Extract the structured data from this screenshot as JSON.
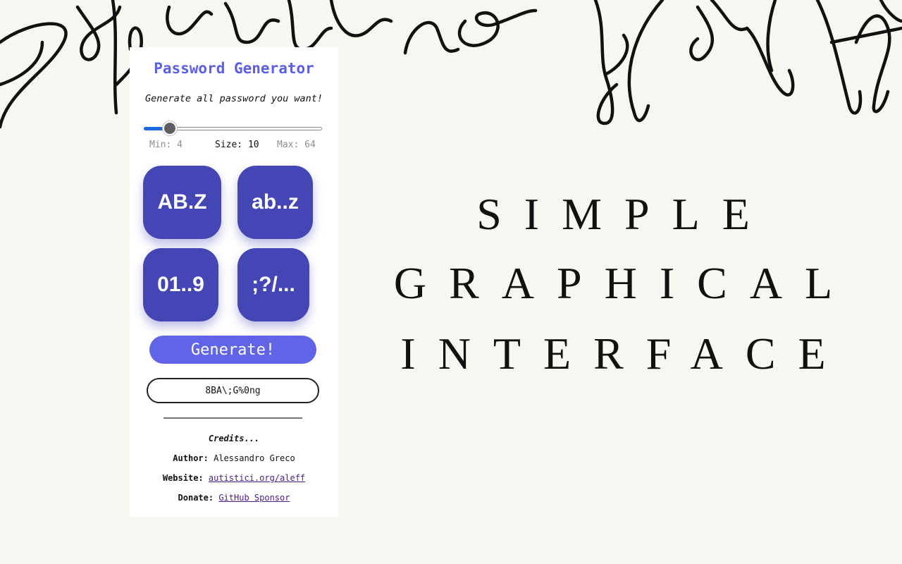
{
  "background": {
    "signature_text": "Sebastiano Beretta",
    "color": "#f7f6f1"
  },
  "panel": {
    "title": "Password Generator",
    "subtitle": "Generate all password you want!",
    "slider": {
      "value": 10,
      "min": 4,
      "max": 64,
      "fill_color": "#1a6ae0"
    },
    "size_row": {
      "min_text": "Min: 4",
      "size_label": "Size:",
      "size_value": "10",
      "max_text": "Max: 64"
    },
    "charset_buttons": [
      {
        "label": "AB.Z",
        "icon": "uppercase"
      },
      {
        "label": "ab..z",
        "icon": "lowercase"
      },
      {
        "label": "01..9",
        "icon": "digits"
      },
      {
        "label": ";?/...",
        "icon": "symbols"
      }
    ],
    "generate_label": "Generate!",
    "output_value": "8BA\\;G%0ng",
    "credits": {
      "heading": "Credits...",
      "author_label": "Author:",
      "author_value": "Alessandro Greco",
      "website_label": "Website:",
      "website_value": "autistici.org/aleff",
      "donate_label": "Donate:",
      "donate_value": "GitHub Sponsor"
    },
    "colors": {
      "accent": "#5b5ee8",
      "button": "#4546b5",
      "generate": "#6064e6",
      "link": "#4b1a8a"
    }
  },
  "tagline": {
    "line1": "SIMPLE",
    "line2": "GRAPHICAL",
    "line3": "INTERFACE"
  }
}
